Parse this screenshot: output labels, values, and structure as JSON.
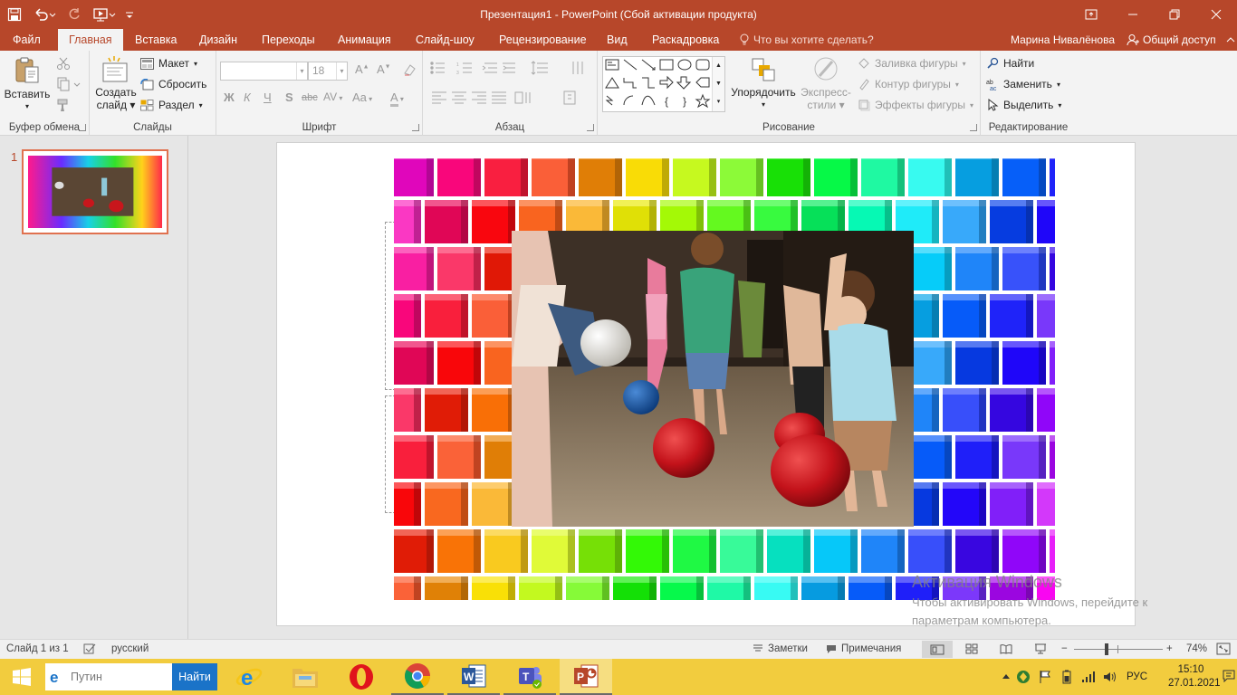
{
  "window": {
    "title": "Презентация1 - PowerPoint (Сбой активации продукта)",
    "accent": "#b7472a"
  },
  "tabs": {
    "items": [
      "Файл",
      "Главная",
      "Вставка",
      "Дизайн",
      "Переходы",
      "Анимация",
      "Слайд-шоу",
      "Рецензирование",
      "Вид",
      "Раскадровка"
    ],
    "active": "Главная",
    "tell_me": "Что вы хотите сделать?",
    "user": "Марина Нивалёнова",
    "share": "Общий доступ"
  },
  "ribbon": {
    "clipboard": {
      "paste": "Вставить",
      "label": "Буфер обмена"
    },
    "slides": {
      "new_slide_1": "Создать",
      "new_slide_2": "слайд",
      "layout": "Макет",
      "reset": "Сбросить",
      "section": "Раздел",
      "label": "Слайды"
    },
    "font": {
      "font_size": "18",
      "label": "Шрифт",
      "bold": "Ж",
      "italic": "К",
      "underline": "Ч",
      "shadow": "S",
      "strike": "abc",
      "spacing": "AV",
      "case": "Aa",
      "color": "A"
    },
    "paragraph": {
      "label": "Абзац"
    },
    "drawing": {
      "arrange": "Упорядочить",
      "quick_styles_1": "Экспресс-",
      "quick_styles_2": "стили",
      "fill": "Заливка фигуры",
      "outline": "Контур фигуры",
      "effects": "Эффекты фигуры",
      "label": "Рисование"
    },
    "editing": {
      "find": "Найти",
      "replace": "Заменить",
      "select": "Выделить",
      "label": "Редактирование"
    }
  },
  "thumbnails": [
    {
      "number": "1"
    }
  ],
  "watermark": {
    "line1": "Активация Windows",
    "line2": "Чтобы активировать Windows, перейдите к",
    "line3": "параметрам компьютера."
  },
  "statusbar": {
    "slide_info": "Слайд 1 из 1",
    "language": "русский",
    "notes": "Заметки",
    "comments": "Примечания",
    "zoom": "74%",
    "zoom_level": 0.74
  },
  "taskbar": {
    "search_placeholder": "Путин",
    "search_button": "Найти",
    "apps": [
      "internet-explorer",
      "file-explorer",
      "opera",
      "chrome",
      "word",
      "teams",
      "powerpoint"
    ],
    "language": "РУС",
    "time": "15:10",
    "date": "27.01.2021"
  }
}
